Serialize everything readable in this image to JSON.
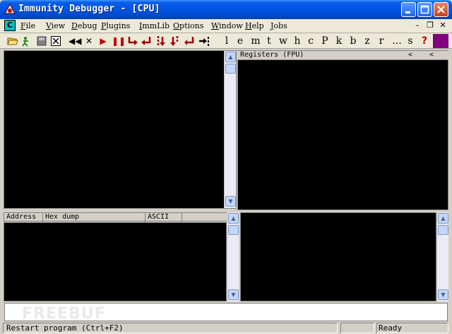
{
  "window": {
    "title": "Immunity Debugger - [CPU]"
  },
  "menu": {
    "items": [
      {
        "u": "F",
        "rest": "ile"
      },
      {
        "u": "V",
        "rest": "iew"
      },
      {
        "u": "D",
        "rest": "ebug"
      },
      {
        "u": "P",
        "rest": "lugins"
      },
      {
        "u": "I",
        "rest": "mmLib"
      },
      {
        "u": "O",
        "rest": "ptions"
      },
      {
        "u": "W",
        "rest": "indow"
      },
      {
        "u": "H",
        "rest": "elp"
      },
      {
        "u": "J",
        "rest": "obs"
      }
    ],
    "mdi_icon": "C"
  },
  "toolbar": {
    "letters": [
      "l",
      "e",
      "m",
      "t",
      "w",
      "h",
      "c",
      "P",
      "k",
      "b",
      "z",
      "r",
      "...",
      "s",
      "?"
    ]
  },
  "registers": {
    "title": "Registers (FPU)",
    "nav_left": "<",
    "nav_right": "<"
  },
  "dump": {
    "columns": [
      "Address",
      "Hex dump",
      "ASCII"
    ]
  },
  "status": {
    "message": "Restart program (Ctrl+F2)",
    "state": "Ready"
  },
  "watermark": "FREEBUF"
}
